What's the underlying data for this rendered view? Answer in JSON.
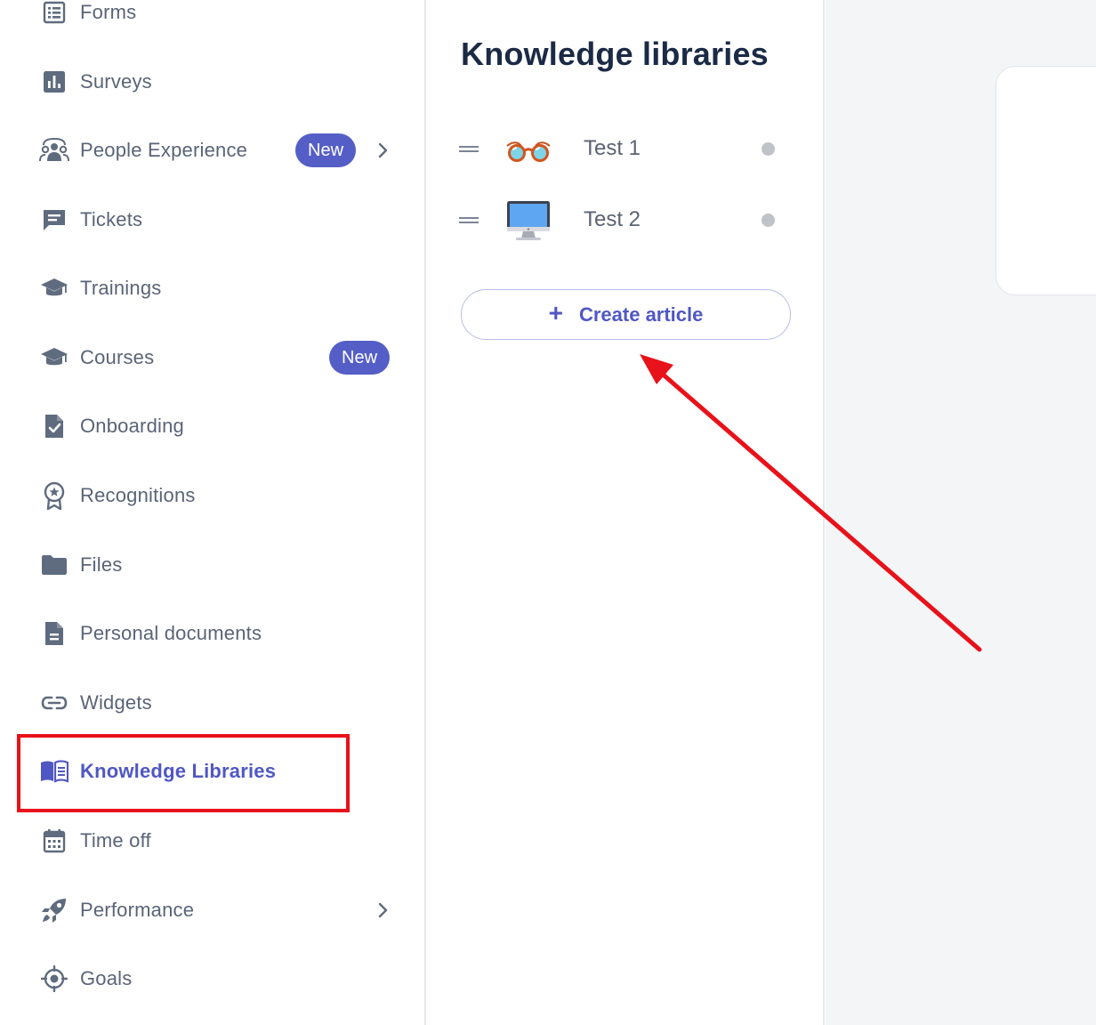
{
  "sidebar": {
    "items": [
      {
        "label": "Forms"
      },
      {
        "label": "Surveys"
      },
      {
        "label": "People Experience",
        "badge": "New"
      },
      {
        "label": "Tickets"
      },
      {
        "label": "Trainings"
      },
      {
        "label": "Courses",
        "badge": "New"
      },
      {
        "label": "Onboarding"
      },
      {
        "label": "Recognitions"
      },
      {
        "label": "Files"
      },
      {
        "label": "Personal documents"
      },
      {
        "label": "Widgets"
      },
      {
        "label": "Knowledge Libraries",
        "active": true
      },
      {
        "label": "Time off"
      },
      {
        "label": "Performance"
      },
      {
        "label": "Goals"
      }
    ]
  },
  "panel": {
    "title": "Knowledge libraries",
    "articles": [
      {
        "title": "Test 1",
        "icon": "glasses-icon"
      },
      {
        "title": "Test 2",
        "icon": "desktop-computer-icon"
      }
    ],
    "create_label": "Create article"
  },
  "colors": {
    "accent": "#555ec6",
    "sidebar_text": "#5a6477",
    "title_text": "#1b2a45",
    "annotation_red": "#e8121a",
    "background_right": "#f4f5f7"
  }
}
